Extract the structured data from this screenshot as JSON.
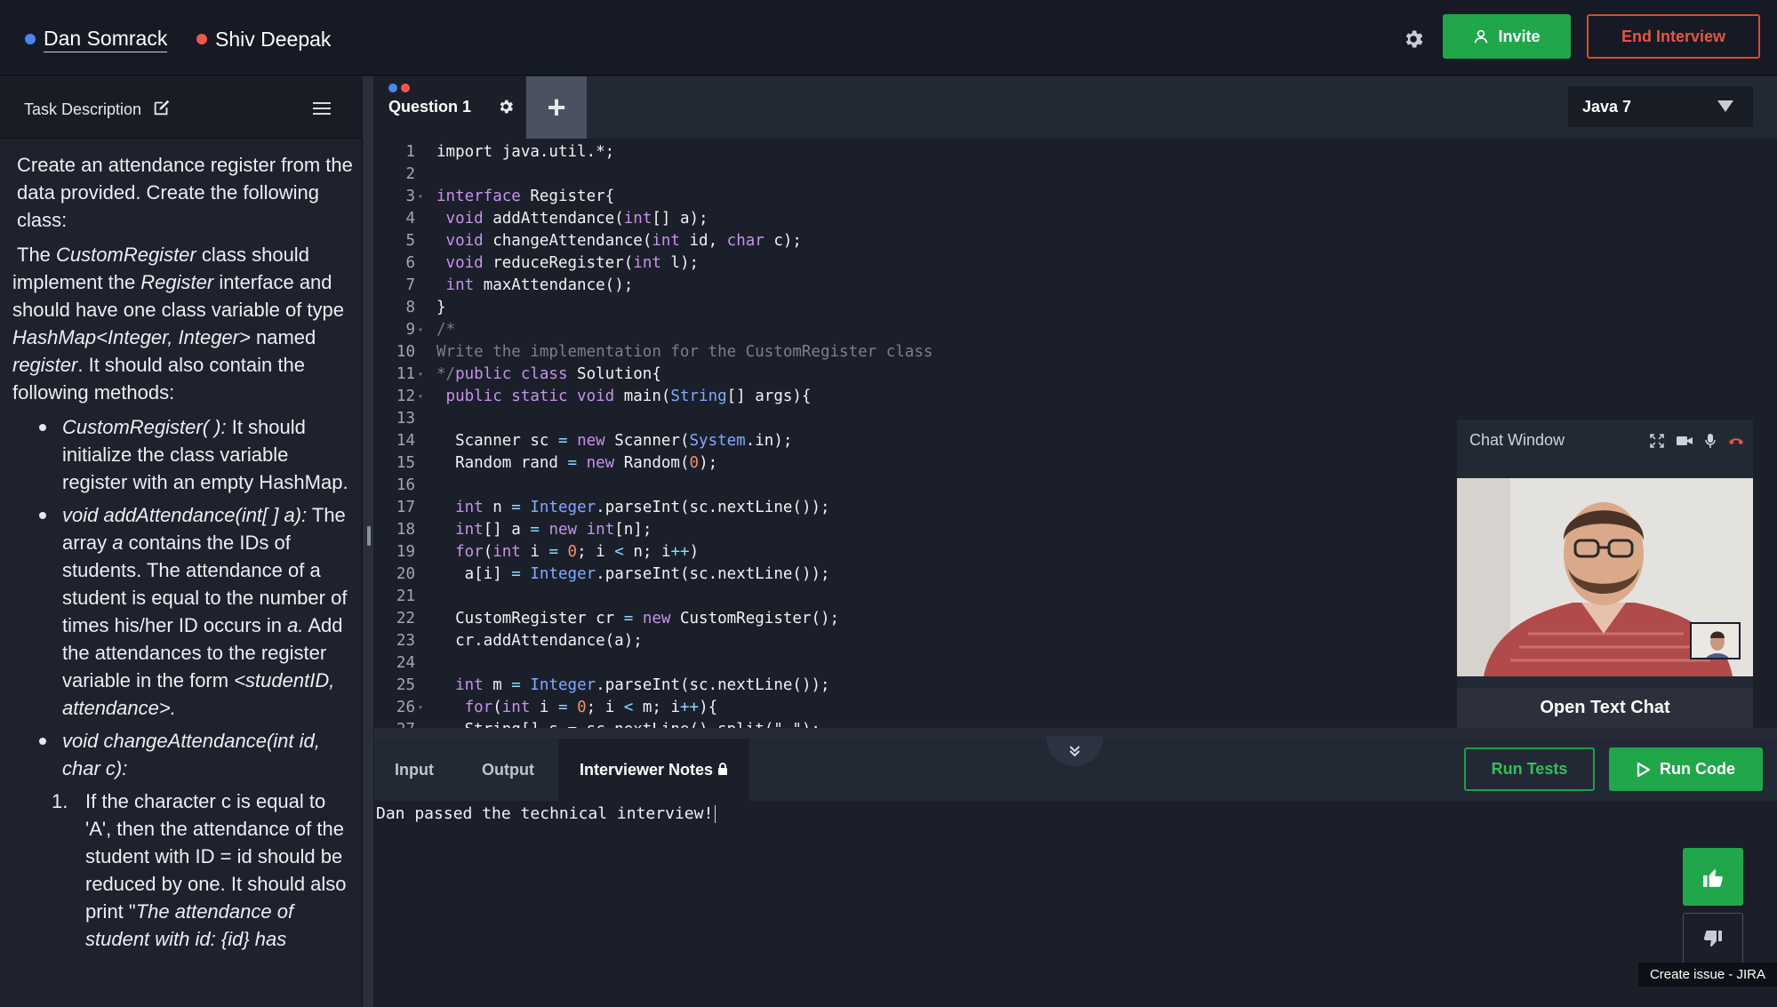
{
  "participants": [
    {
      "name": "Dan Somrack",
      "color": "#4c84f2"
    },
    {
      "name": "Shiv Deepak",
      "color": "#f2564b"
    }
  ],
  "header": {
    "invite_label": "Invite",
    "end_label": "End Interview",
    "settings_icon": "gear-icon"
  },
  "task": {
    "title": "Task Description",
    "intro": "Create an attendance register from the data provided. Create the following class:",
    "p2_a": "The ",
    "p2_class": "CustomRegister",
    "p2_b": " class should implement the ",
    "p2_iface": "Register",
    "p2_c": " interface and should have one class variable of type ",
    "p2_type": "HashMap<Integer, Integer>",
    "p2_d": " named ",
    "p2_var": "register",
    "p2_e": ". It should also contain the following methods:",
    "m1_sig": "CustomRegister( ):",
    "m1_desc": " It should initialize the class variable register with an empty HashMap.",
    "m2_sig": "void addAttendance(int[ ] a):",
    "m2_a": " The array ",
    "m2_var": "a",
    "m2_b": " contains the IDs of students. The attendance of a student is equal to the number of times his/her ID occurs in ",
    "m2_var2": "a.",
    "m2_c": " Add the attendances to the register variable in the form ",
    "m2_form": "<studentID, attendance>.",
    "m3_sig": "void changeAttendance(int id, char c):",
    "step1_num": "1.",
    "step1_a": "If the character c is equal to 'A', then the attendance of the student with ID = id should be reduced by one. It should also print \"",
    "step1_b": "The attendance of student with id: {id} has"
  },
  "editor": {
    "tab_label": "Question 1",
    "tab_dot_colors": [
      "#4c84f2",
      "#f2564b"
    ],
    "add_tab": "+",
    "language": "Java 7",
    "lines": [
      {
        "n": "1",
        "fold": false,
        "html": "import java.util.*;"
      },
      {
        "n": "2",
        "fold": false,
        "html": ""
      },
      {
        "n": "3",
        "fold": true,
        "html": "<span class='kw'>interface</span> Register{"
      },
      {
        "n": "4",
        "fold": false,
        "html": " <span class='kw'>void</span> addAttendance(<span class='kw'>int</span>[] a);"
      },
      {
        "n": "5",
        "fold": false,
        "html": " <span class='kw'>void</span> changeAttendance(<span class='kw'>int</span> id, <span class='kw'>char</span> c);"
      },
      {
        "n": "6",
        "fold": false,
        "html": " <span class='kw'>void</span> reduceRegister(<span class='kw'>int</span> l);"
      },
      {
        "n": "7",
        "fold": false,
        "html": " <span class='kw'>int</span> maxAttendance();"
      },
      {
        "n": "8",
        "fold": false,
        "html": "}"
      },
      {
        "n": "9",
        "fold": true,
        "html": "<span class='cm'>/*</span>"
      },
      {
        "n": "10",
        "fold": false,
        "html": "<span class='cm'>Write the implementation for the CustomRegister class</span>"
      },
      {
        "n": "11",
        "fold": true,
        "html": "<span class='cm'>*/</span><span class='kw'>public class</span> Solution{"
      },
      {
        "n": "12",
        "fold": true,
        "html": " <span class='kw'>public static void</span> main(<span class='ty'>String</span>[] args){"
      },
      {
        "n": "13",
        "fold": false,
        "html": ""
      },
      {
        "n": "14",
        "fold": false,
        "html": "  Scanner sc <span class='op'>=</span> <span class='kw'>new</span> Scanner(<span class='ty'>System</span>.in);"
      },
      {
        "n": "15",
        "fold": false,
        "html": "  Random rand <span class='op'>=</span> <span class='kw'>new</span> Random(<span class='nm'>0</span>);"
      },
      {
        "n": "16",
        "fold": false,
        "html": ""
      },
      {
        "n": "17",
        "fold": false,
        "html": "  <span class='kw'>int</span> n <span class='op'>=</span> <span class='ty'>Integer</span>.parseInt(sc.nextLine());"
      },
      {
        "n": "18",
        "fold": false,
        "html": "  <span class='kw'>int</span>[] a <span class='op'>=</span> <span class='kw'>new</span> <span class='kw'>int</span>[n];"
      },
      {
        "n": "19",
        "fold": false,
        "html": "  <span class='kw'>for</span>(<span class='kw'>int</span> i <span class='op'>=</span> <span class='nm'>0</span>; i <span class='op'>&lt;</span> n; i<span class='op'>++</span>)"
      },
      {
        "n": "20",
        "fold": false,
        "html": "   a[i] <span class='op'>=</span> <span class='ty'>Integer</span>.parseInt(sc.nextLine());"
      },
      {
        "n": "21",
        "fold": false,
        "html": ""
      },
      {
        "n": "22",
        "fold": false,
        "html": "  CustomRegister cr <span class='op'>=</span> <span class='kw'>new</span> CustomRegister();"
      },
      {
        "n": "23",
        "fold": false,
        "html": "  cr.addAttendance(a);"
      },
      {
        "n": "24",
        "fold": false,
        "html": ""
      },
      {
        "n": "25",
        "fold": false,
        "html": "  <span class='kw'>int</span> m <span class='op'>=</span> <span class='ty'>Integer</span>.parseInt(sc.nextLine());"
      },
      {
        "n": "26",
        "fold": true,
        "html": "   <span class='kw'>for</span>(<span class='kw'>int</span> i <span class='op'>=</span> <span class='nm'>0</span>; i <span class='op'>&lt;</span> m; i<span class='op'>++</span>){"
      },
      {
        "n": "27",
        "fold": false,
        "html": "   String[] s = sc.nextLine().split(\" \");"
      }
    ]
  },
  "bottom": {
    "tabs": [
      "Input",
      "Output",
      "Interviewer Notes"
    ],
    "active_tab": "Interviewer Notes",
    "run_tests": "Run Tests",
    "run_code": "Run Code",
    "notes_text": "Dan passed the technical interview!"
  },
  "chat": {
    "title": "Chat Window",
    "open_text_chat": "Open Text Chat",
    "icons": [
      "fullscreen-icon",
      "camera-icon",
      "microphone-icon",
      "hang-up-icon"
    ]
  },
  "feedback": {
    "tooltip": "Create issue - JIRA",
    "thumbs_up_icon": "thumbs-up-icon",
    "thumbs_down_icon": "thumbs-down-icon"
  },
  "colors": {
    "accent_green": "#1fa74a",
    "danger": "#e8553d",
    "background": "#1b1f2a"
  }
}
